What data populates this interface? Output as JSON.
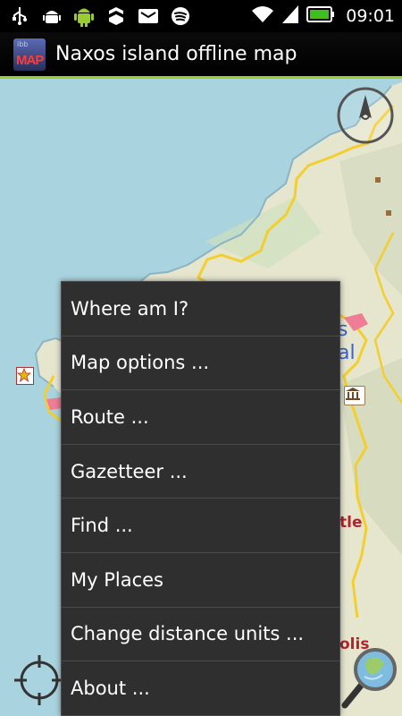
{
  "status_bar": {
    "time": "09:01",
    "icons": [
      "usb-icon",
      "android-debug-icon",
      "android-icon",
      "nfc-icon",
      "message-icon",
      "spotify-icon"
    ],
    "signal_icons": [
      "wifi-icon",
      "cell-signal-icon",
      "battery-icon"
    ]
  },
  "app": {
    "title": "Naxos island offline map",
    "icon_text": "MAP",
    "icon_small_text": "ibb"
  },
  "map": {
    "labels": [
      {
        "text": "s",
        "color": "#3a62c8"
      },
      {
        "text": "al",
        "color": "#3a62c8"
      },
      {
        "text": "tle",
        "color": "#b2232b"
      },
      {
        "text": "olis",
        "color": "#b2232b"
      }
    ],
    "colors": {
      "sea": "#a9d3de",
      "land": "#e6e6cf",
      "road": "#f5d339"
    }
  },
  "menu": {
    "items": [
      "Where am I?",
      "Map options ...",
      "Route ...",
      "Gazetteer ...",
      "Find ...",
      "My Places",
      "Change distance units ...",
      "About ..."
    ]
  }
}
